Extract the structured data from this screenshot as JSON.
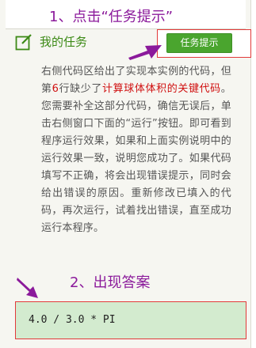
{
  "annotations": {
    "step1": "1、点击“任务提示”",
    "step2": "2、出现答案",
    "color": "#8b1a9b"
  },
  "task": {
    "title": "我的任务",
    "hint_button_label": "任务提示",
    "icon": "edit-square-icon",
    "description_parts": {
      "p1": "右侧代码区给出了实现本实例的代码，但第",
      "line_number": "6",
      "p2": "行缺少了",
      "highlight": "计算球体体积的关键代码",
      "p3": "。您需要补全这部分代码，确信无误后，单击右侧窗口下面的“运行”按钮。即可看到程序运行效果，如果和上面实例说明中的运行效果一致，说明您成功了。如果代码填写不正确，将会出现错误提示，同时会给出错误的原因。重新修改已填入的代码，再次运行，试着找出错误，直至成功运行本程序。"
    }
  },
  "answer": {
    "code": "4.0 / 3.0 * PI"
  },
  "colors": {
    "brand_green": "#4aa52e",
    "title_green": "#3c8a16",
    "highlight_red": "#d01010",
    "answer_bg": "#d3ebcf"
  }
}
